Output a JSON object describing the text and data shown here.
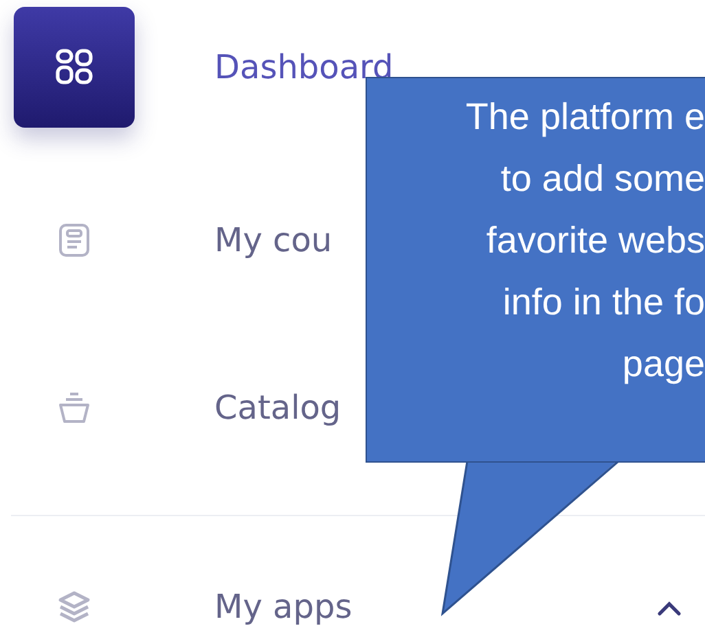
{
  "sidebar": {
    "items": [
      {
        "label": "Dashboard",
        "selected": true
      },
      {
        "label": "My cou",
        "selected": false
      },
      {
        "label": "Catalog",
        "selected": false
      },
      {
        "label": "My apps",
        "selected": false,
        "expanded": true
      }
    ]
  },
  "callout": {
    "lines": [
      "The platform e",
      "to add some",
      "favorite webs",
      "info in the fo",
      "page"
    ]
  }
}
